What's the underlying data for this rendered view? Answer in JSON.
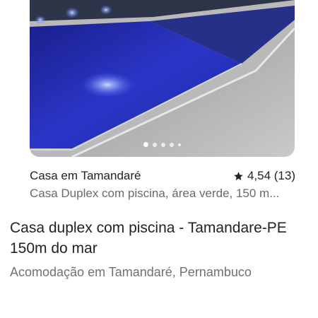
{
  "listing_card": {
    "title": "Casa em Tamandaré",
    "rating": "4,54 (13)",
    "subtitle": "Casa Duplex com piscina, área verde, 150 m...",
    "photo_dots": 5,
    "active_dot": 0,
    "star_icon": "star-icon"
  },
  "page": {
    "heading": "Casa duplex com piscina - Tamandare-PE 150m do mar",
    "location": "Acomodação em Tamandaré, Pernambuco"
  }
}
